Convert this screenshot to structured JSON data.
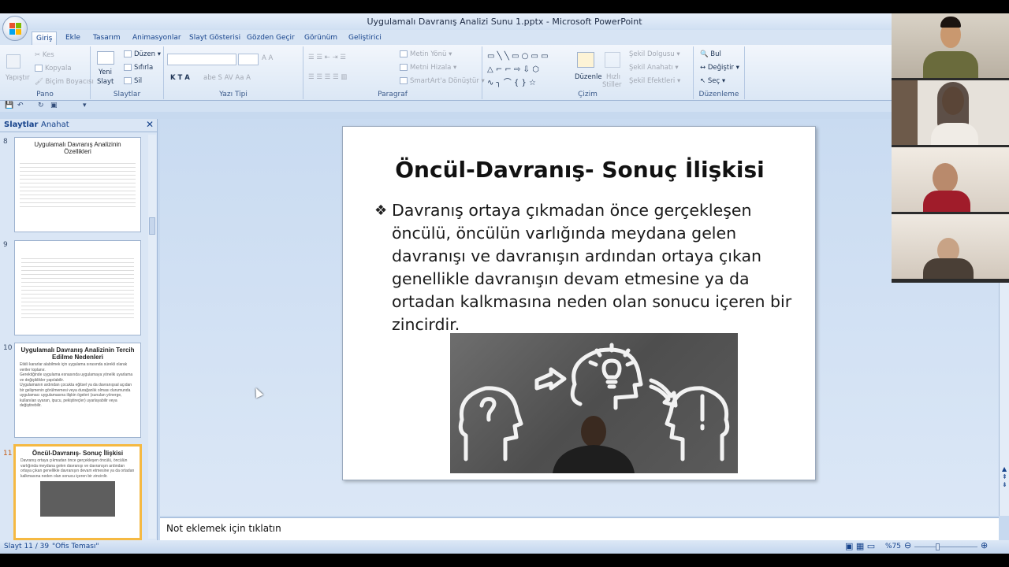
{
  "window": {
    "title": "Uygulamalı Davranış Analizi Sunu 1.pptx - Microsoft PowerPoint"
  },
  "menu": {
    "tabs": [
      "Giriş",
      "Ekle",
      "Tasarım",
      "Animasyonlar",
      "Slayt Gösterisi",
      "Gözden Geçir",
      "Görünüm",
      "Geliştirici"
    ]
  },
  "ribbon": {
    "pano": {
      "label": "Pano",
      "paste": "Yapıştır",
      "cut": "Kes",
      "copy": "Kopyala",
      "format_painter": "Biçim Boyacısı"
    },
    "slaytlar": {
      "label": "Slaytlar",
      "new_slide_line1": "Yeni",
      "new_slide_line2": "Slayt",
      "layout": "Düzen",
      "reset": "Sıfırla",
      "delete": "Sil"
    },
    "yazi_tipi": {
      "label": "Yazı Tipi"
    },
    "paragraf": {
      "label": "Paragraf",
      "text_direction": "Metin Yönü",
      "align_text": "Metni Hizala",
      "smartart": "SmartArt'a Dönüştür"
    },
    "cizim": {
      "label": "Çizim",
      "arrange": "Düzenle",
      "quick_styles_line1": "Hızlı",
      "quick_styles_line2": "Stiller",
      "shape_fill": "Şekil Dolgusu",
      "shape_outline": "Şekil Anahatı",
      "shape_effects": "Şekil Efektleri"
    },
    "duzenleme": {
      "label": "Düzenleme",
      "find": "Bul",
      "replace": "Değiştir",
      "select": "Seç"
    }
  },
  "left_panel": {
    "tabs": [
      "Slaytlar",
      "Anahat"
    ],
    "slides": [
      {
        "num": "8",
        "title": "Uygulamalı Davranış Analizinin Özellikleri"
      },
      {
        "num": "9",
        "title": ""
      },
      {
        "num": "10",
        "title": "Uygulamalı Davranış Analizinin Tercih Edilme Nedenleri",
        "lines": [
          "Etkili kararlar alabilmek için uygulama sırasında sürekli olarak veriler toplanır.",
          "Gerektiğinde uygulama esnasında uygulamaya yönelik uyarlama ve değişiklikler yapılabilir.",
          "Uygulamanın ardından çocukta eğitsel ya da davranışsal açıdan bir gelişmenin görülmemesi veya durağanlık olması durumunda uygulamacı uygulamasına ilişkin ögeleri (sunulan yönerge, kullanılan uyaran, ipucu, pekiştireçler) uyarlayabilir veya değiştirebilir."
        ]
      },
      {
        "num": "11",
        "title": "Öncül-Davranış- Sonuç İlişkisi",
        "lines": [
          "Davranış ortaya çıkmadan önce gerçekleşen öncülü, öncülün varlığında meydana gelen davranışı ve davranışın ardından ortaya çıkan genellikle davranışın devam etmesine ya da ortadan kalkmasına neden olan sonucu içeren bir zincirdir."
        ]
      }
    ]
  },
  "slide": {
    "title": "Öncül-Davranış- Sonuç İlişkisi",
    "body": "Davranış ortaya çıkmadan önce gerçekleşen öncülü, öncülün varlığında meydana gelen davranışı ve davranışın ardından ortaya çıkan genellikle davranışın devam etmesine ya da ortadan kalkmasına neden olan sonucu içeren bir zincirdir."
  },
  "notes": {
    "placeholder": "Not eklemek için tıklatın"
  },
  "status": {
    "slide_info": "Slayt 11 / 39",
    "theme": "\"Ofis Teması\"",
    "zoom": "%75"
  }
}
